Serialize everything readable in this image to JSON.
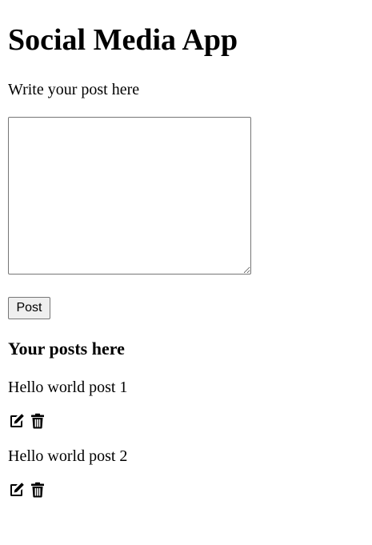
{
  "header": {
    "title": "Social Media App"
  },
  "composer": {
    "prompt": "Write your post here",
    "textarea_value": "",
    "post_button_label": "Post"
  },
  "posts_section": {
    "heading": "Your posts here",
    "posts": [
      {
        "text": "Hello world post 1",
        "actions": [
          "edit-icon",
          "trash-icon"
        ]
      },
      {
        "text": "Hello world post 2",
        "actions": [
          "edit-icon",
          "trash-icon"
        ]
      }
    ]
  },
  "colors": {
    "text": "#000000",
    "background": "#ffffff",
    "button_background": "#efefef",
    "border": "#767676"
  }
}
